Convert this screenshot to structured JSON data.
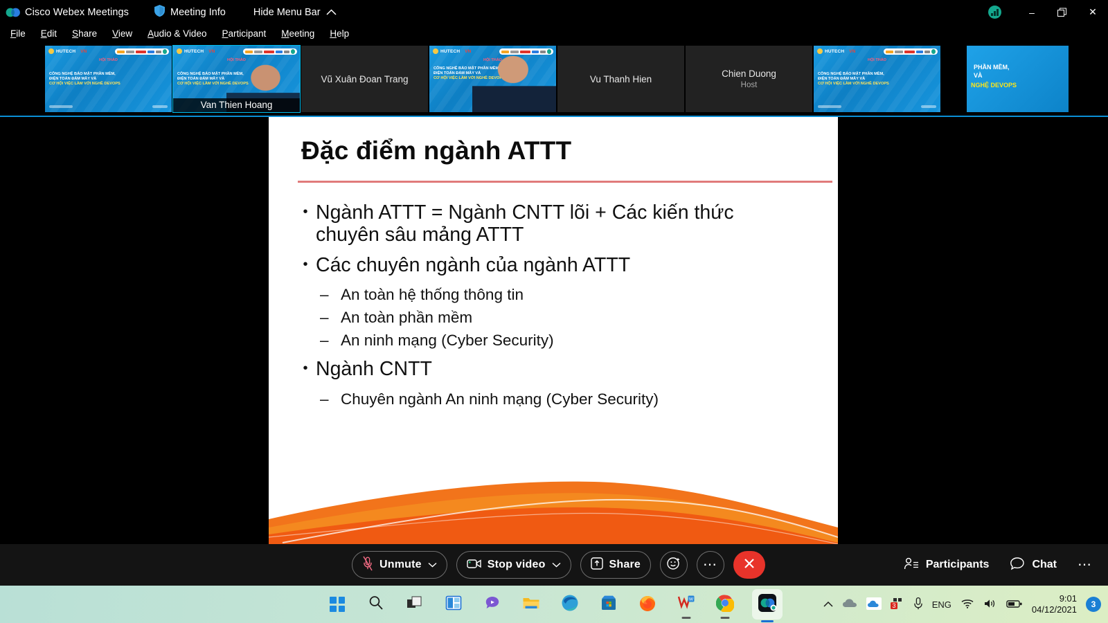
{
  "titlebar": {
    "app_title": "Cisco Webex Meetings",
    "meeting_info_label": "Meeting Info",
    "hide_menu_label": "Hide Menu Bar",
    "logo_icon": "webex-logo-icon",
    "shield_icon": "shield-icon",
    "chevron_up_icon": "chevron-up-icon",
    "connection_icon": "connection-strength-icon",
    "minimize_label": "–",
    "restore_label": "❐",
    "close_label": "✕"
  },
  "menubar": {
    "items": [
      {
        "label": "File",
        "mnemonic": "F",
        "rest": "ile"
      },
      {
        "label": "Edit",
        "mnemonic": "E",
        "rest": "dit"
      },
      {
        "label": "Share",
        "mnemonic": "S",
        "rest": "hare"
      },
      {
        "label": "View",
        "mnemonic": "V",
        "rest": "iew"
      },
      {
        "label": "Audio & Video",
        "mnemonic": "A",
        "rest": "udio & Video"
      },
      {
        "label": "Participant",
        "mnemonic": "P",
        "rest": "articipant"
      },
      {
        "label": "Meeting",
        "mnemonic": "M",
        "rest": "eeting"
      },
      {
        "label": "Help",
        "mnemonic": "H",
        "rest": "elp"
      }
    ]
  },
  "filmstrip": {
    "thumbnails": [
      {
        "name": "",
        "role": "",
        "type": "slide",
        "active": false
      },
      {
        "name": "Van Thien Hoang",
        "role": "",
        "type": "slide-person",
        "active": true
      },
      {
        "name": "Vũ Xuân Đoan Trang",
        "role": "",
        "type": "name-only",
        "active": false
      },
      {
        "name": "",
        "role": "",
        "type": "slide-person2",
        "active": false
      },
      {
        "name": "Vu Thanh Hien",
        "role": "",
        "type": "name-only",
        "active": false
      },
      {
        "name": "Chien Duong",
        "role": "Host",
        "type": "name-only",
        "active": false
      },
      {
        "name": "",
        "role": "",
        "type": "slide",
        "active": false
      },
      {
        "name": "",
        "role": "",
        "type": "zoomed-slide",
        "active": false
      }
    ],
    "slide_art": {
      "brand": "HUTECH",
      "brand_accent": "VN",
      "red_tag": "HỘI THẢO",
      "line1": "CÔNG NGHỆ BẢO MẬT PHẦN MỀM,",
      "line2": "ĐIỆN TOÁN ĐÁM MÂY VÀ",
      "line3": "CƠ HỘI VIỆC LÀM VỚI NGHỀ DEVOPS"
    },
    "zoomed_slide": {
      "line1": "PHẦN MỀM,",
      "line2": "VÀ",
      "line3": "NGHỆ DEVOPS"
    }
  },
  "slide": {
    "title": "Đặc điểm ngành ATTT",
    "bullet_marker": "•",
    "dash_marker": "–",
    "blocks": [
      {
        "level": 1,
        "text": "Ngành ATTT = Ngành CNTT lõi + Các kiến thức chuyên sâu mảng ATTT"
      },
      {
        "level": 1,
        "text": "Các chuyên ngành của ngành ATTT"
      },
      {
        "level": 2,
        "text": "An toàn hệ thống thông tin"
      },
      {
        "level": 2,
        "text": "An toàn phần mềm"
      },
      {
        "level": 2,
        "text": "An ninh mạng (Cyber Security)"
      },
      {
        "level": 1,
        "text": "Ngành CNTT"
      },
      {
        "level": 2,
        "text": "Chuyên ngành An ninh mạng (Cyber Security)"
      }
    ],
    "accent_rule_color": "#e07b7b",
    "wave_color": "#f26a1b"
  },
  "controlbar": {
    "mute_label": "Unmute",
    "mute_icon": "microphone-muted-icon",
    "video_label": "Stop video",
    "video_icon": "video-camera-icon",
    "share_label": "Share",
    "share_icon": "share-screen-icon",
    "reactions_icon": "reactions-smiley-icon",
    "more_icon": "more-options-icon",
    "end_icon": "end-meeting-icon",
    "chevron_icon": "chevron-down-icon",
    "participants_label": "Participants",
    "participants_icon": "participants-icon",
    "chat_label": "Chat",
    "chat_icon": "chat-bubble-icon",
    "right_more_icon": "more-options-icon",
    "end_color": "#e8332a"
  },
  "taskbar": {
    "icons": [
      {
        "name": "start-button"
      },
      {
        "name": "search-icon"
      },
      {
        "name": "task-view-icon"
      },
      {
        "name": "widgets-icon"
      },
      {
        "name": "teams-chat-icon"
      },
      {
        "name": "file-explorer-icon"
      },
      {
        "name": "microsoft-edge-icon"
      },
      {
        "name": "microsoft-store-icon"
      },
      {
        "name": "firefox-icon"
      },
      {
        "name": "wps-office-icon"
      },
      {
        "name": "google-chrome-icon"
      },
      {
        "name": "webex-taskbar-icon"
      }
    ],
    "tray": {
      "chevron_icon": "show-hidden-icons-icon",
      "cloud_icon": "cloud-icon",
      "onedrive_icon": "onedrive-icon",
      "app_badge_icon": "notification-app-icon",
      "app_badge_count": "3",
      "mic_icon": "microphone-icon",
      "language": "ENG",
      "wifi_icon": "wifi-icon",
      "volume_icon": "volume-icon",
      "battery_icon": "battery-icon",
      "time": "9:01",
      "date": "04/12/2021",
      "notification_count": "3"
    }
  }
}
